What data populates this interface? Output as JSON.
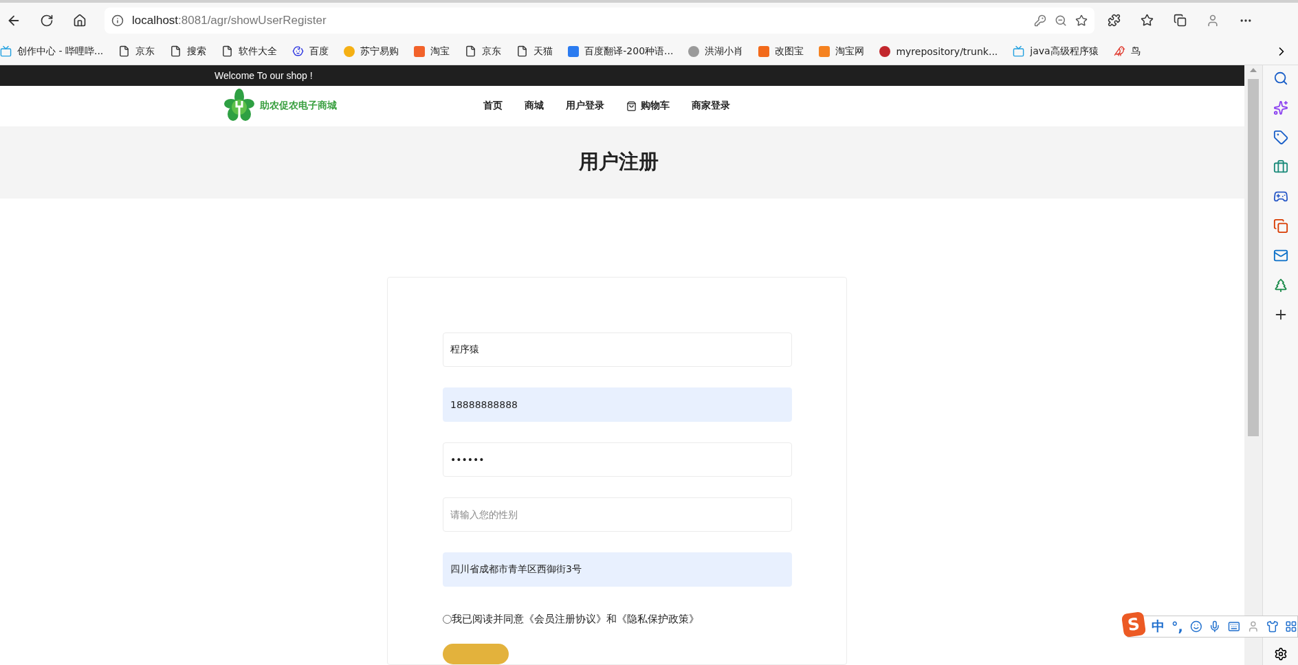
{
  "browser": {
    "url_host": "localhost",
    "url_path": ":8081/agr/showUserRegister",
    "bookmarks": [
      {
        "label": "创作中心 - 哔哩哔...",
        "kind": "tv",
        "color": "#20a0e0"
      },
      {
        "label": "京东",
        "kind": "page",
        "color": "#333333"
      },
      {
        "label": "搜索",
        "kind": "page",
        "color": "#333333"
      },
      {
        "label": "软件大全",
        "kind": "page",
        "color": "#333333"
      },
      {
        "label": "百度",
        "kind": "paw",
        "color": "#2932e1"
      },
      {
        "label": "苏宁易购",
        "kind": "circle",
        "color": "#f5b014"
      },
      {
        "label": "淘宝",
        "kind": "square",
        "color": "#f2622a"
      },
      {
        "label": "京东",
        "kind": "page",
        "color": "#333333"
      },
      {
        "label": "天猫",
        "kind": "page",
        "color": "#333333"
      },
      {
        "label": "百度翻译-200种语...",
        "kind": "square",
        "color": "#2b7bf0"
      },
      {
        "label": "洪湖小肖",
        "kind": "circle",
        "color": "#9a9a9a"
      },
      {
        "label": "改图宝",
        "kind": "square",
        "color": "#f26a1b"
      },
      {
        "label": "淘宝网",
        "kind": "square",
        "color": "#f58220"
      },
      {
        "label": "myrepository/trunk...",
        "kind": "circle",
        "color": "#c2272d"
      },
      {
        "label": "java高级程序猿",
        "kind": "tv",
        "color": "#20a0e0"
      },
      {
        "label": "鸟",
        "kind": "bird",
        "color": "#e03c31"
      }
    ]
  },
  "topbar": {
    "welcome": "Welcome To our shop !"
  },
  "header": {
    "logo_text": "助农促农电子商城",
    "nav": [
      {
        "label": "首页",
        "kind": "text"
      },
      {
        "label": "商城",
        "kind": "text"
      },
      {
        "label": "用户登录",
        "kind": "text"
      },
      {
        "label": "购物车",
        "kind": "cart"
      },
      {
        "label": "商家登录",
        "kind": "text"
      }
    ]
  },
  "banner": {
    "title": "用户注册"
  },
  "form": {
    "fields": [
      {
        "value": "程序猿",
        "autofilled": false
      },
      {
        "value": "18888888888",
        "autofilled": true
      },
      {
        "value": "••••••",
        "autofilled": false
      },
      {
        "placeholder": "请输入您的性别",
        "autofilled": false
      },
      {
        "value": "四川省成都市青羊区西御街3号",
        "autofilled": true
      }
    ],
    "agreement": {
      "text": "我已阅读并同意《会员注册协议》和《隐私保护政策》",
      "checked": false
    }
  },
  "ime": {
    "logo": "S",
    "mode": "中",
    "punct": "°,"
  }
}
